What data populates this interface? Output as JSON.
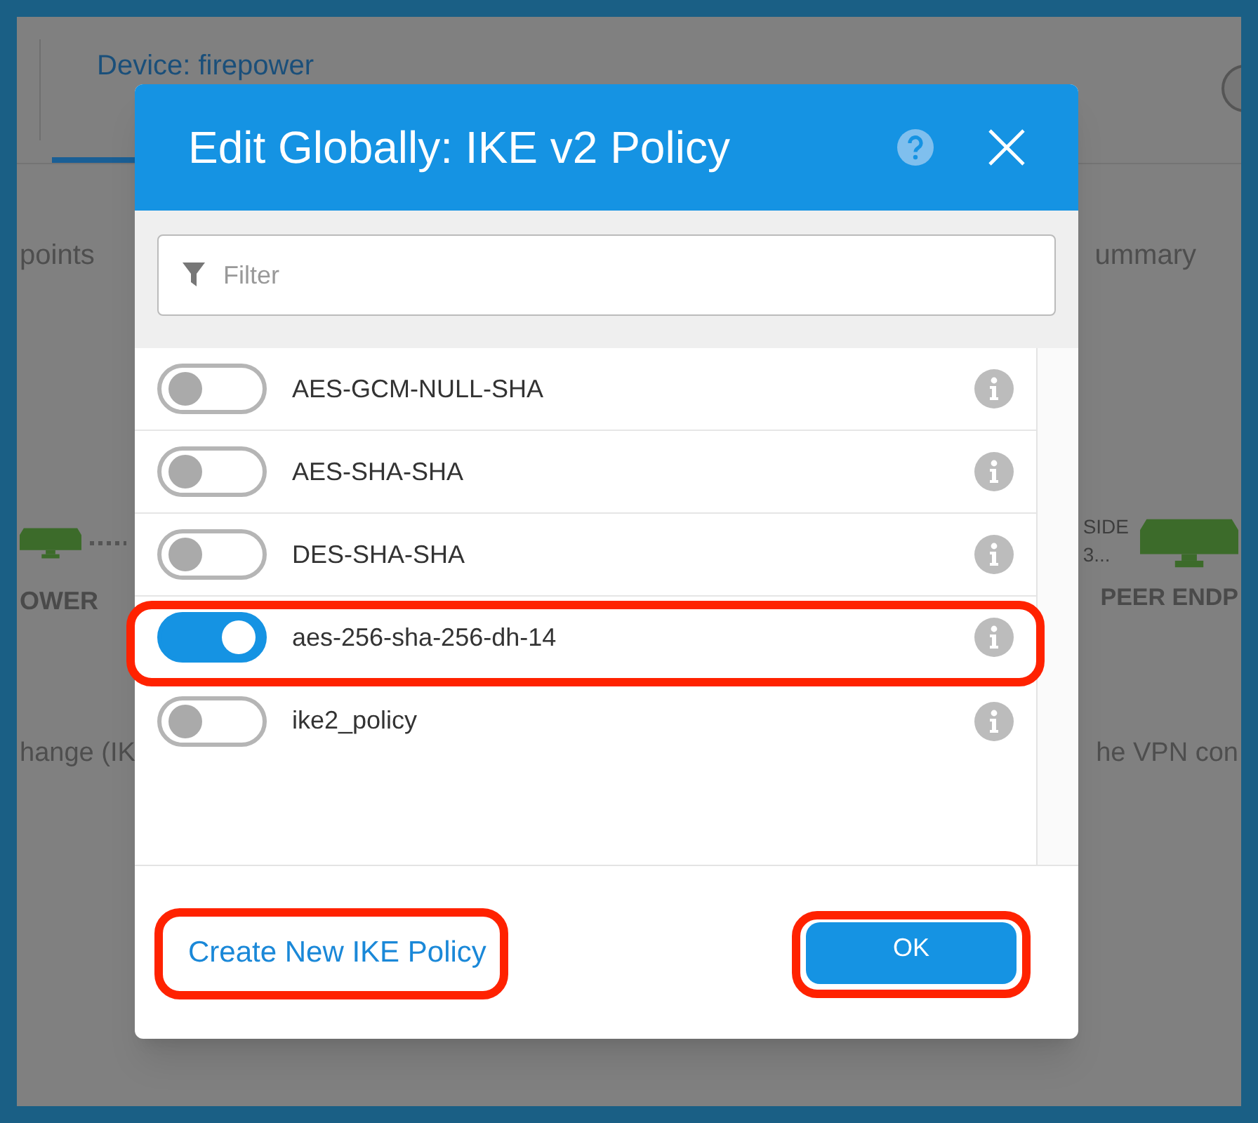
{
  "background": {
    "device_tab": {
      "label": "Device: firepower",
      "selected": true
    },
    "step_left": "points",
    "step_right": "ummary",
    "left_device_label": "OWER",
    "right_device_lines": [
      "SIDE",
      "3..."
    ],
    "right_device_label": "PEER ENDP",
    "text_left": "hange (IK",
    "text_right": "he VPN con"
  },
  "dialog": {
    "title": "Edit Globally: IKE v2 Policy",
    "filter": {
      "placeholder": "Filter"
    },
    "policies": [
      {
        "name": "AES-GCM-NULL-SHA",
        "on": false,
        "highlighted": false
      },
      {
        "name": "AES-SHA-SHA",
        "on": false,
        "highlighted": false
      },
      {
        "name": "DES-SHA-SHA",
        "on": false,
        "highlighted": false
      },
      {
        "name": "aes-256-sha-256-dh-14",
        "on": true,
        "highlighted": true
      },
      {
        "name": "ike2_policy",
        "on": false,
        "highlighted": false
      }
    ],
    "create_link": {
      "label": "Create New IKE Policy",
      "highlighted": true
    },
    "ok_button": {
      "label": "OK",
      "highlighted": true
    }
  }
}
